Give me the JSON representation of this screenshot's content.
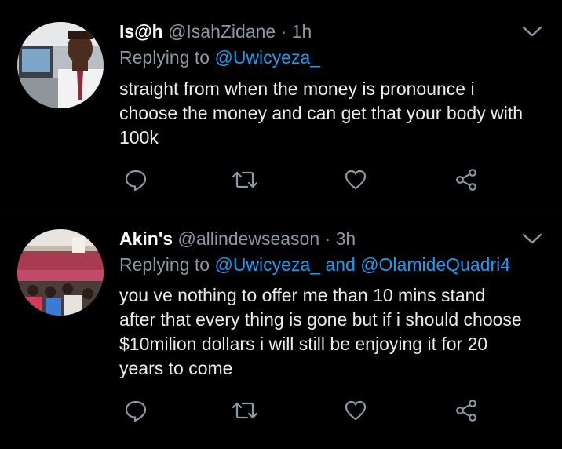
{
  "icons": {
    "menu": "chevron-down-icon",
    "reply": "reply-bubble-icon",
    "retweet": "retweet-icon",
    "like": "heart-icon",
    "share": "share-icon"
  },
  "colors": {
    "background": "#000000",
    "name": "#ffffff",
    "muted": "#8b98a5",
    "link": "#1d9bf0",
    "text": "#ececec",
    "divider": "#2a2a2a"
  },
  "tweets": [
    {
      "display_name": "Is@h",
      "handle": "@IsahZidane",
      "separator": "·",
      "time": "1h",
      "replying_prefix": "Replying to",
      "mentions": [
        "@Uwicyeza_"
      ],
      "mention_joiner": "",
      "body_lines": [
        "straight from when the money is pronounce i",
        "choose the money and can get that your body with",
        "100k"
      ]
    },
    {
      "display_name": "Akin's",
      "handle": "@allindewseason",
      "separator": "·",
      "time": "3h",
      "replying_prefix": "Replying to",
      "mentions": [
        "@Uwicyeza_",
        "@OlamideQuadri4"
      ],
      "mention_joiner": "and",
      "body_lines": [
        "you ve nothing to offer me than 10 mins stand",
        "after that every thing is gone but if i should choose",
        "$10milion dollars i will still be enjoying it for  20",
        "years to come"
      ]
    }
  ]
}
